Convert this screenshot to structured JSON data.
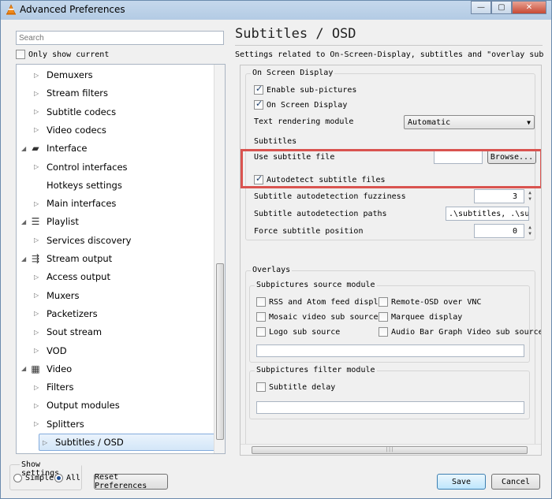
{
  "window": {
    "title": "Advanced Preferences",
    "minimize": "—",
    "maximize": "▢",
    "close": "✕"
  },
  "search": {
    "placeholder": "Search"
  },
  "only_current": {
    "label": "Only show current",
    "checked": false
  },
  "tree": {
    "items": [
      {
        "label": "Demuxers",
        "level": 1,
        "arrow": "▷"
      },
      {
        "label": "Stream filters",
        "level": 1,
        "arrow": "▷"
      },
      {
        "label": "Subtitle codecs",
        "level": 1,
        "arrow": "▷"
      },
      {
        "label": "Video codecs",
        "level": 1,
        "arrow": "▷"
      },
      {
        "label": "Interface",
        "level": 0,
        "arrow": "◢",
        "icon": "paint-roller-icon"
      },
      {
        "label": "Control interfaces",
        "level": 1,
        "arrow": "▷"
      },
      {
        "label": "Hotkeys settings",
        "level": 1,
        "arrow": ""
      },
      {
        "label": "Main interfaces",
        "level": 1,
        "arrow": "▷"
      },
      {
        "label": "Playlist",
        "level": 0,
        "arrow": "◢",
        "icon": "playlist-icon"
      },
      {
        "label": "Services discovery",
        "level": 1,
        "arrow": "▷"
      },
      {
        "label": "Stream output",
        "level": 0,
        "arrow": "◢",
        "icon": "stream-output-icon"
      },
      {
        "label": "Access output",
        "level": 1,
        "arrow": "▷"
      },
      {
        "label": "Muxers",
        "level": 1,
        "arrow": "▷"
      },
      {
        "label": "Packetizers",
        "level": 1,
        "arrow": "▷"
      },
      {
        "label": "Sout stream",
        "level": 1,
        "arrow": "▷"
      },
      {
        "label": "VOD",
        "level": 1,
        "arrow": "▷"
      },
      {
        "label": "Video",
        "level": 0,
        "arrow": "◢",
        "icon": "film-icon"
      },
      {
        "label": "Filters",
        "level": 1,
        "arrow": "▷"
      },
      {
        "label": "Output modules",
        "level": 1,
        "arrow": "▷"
      },
      {
        "label": "Splitters",
        "level": 1,
        "arrow": "▷"
      },
      {
        "label": "Subtitles / OSD",
        "level": 1,
        "arrow": "▷",
        "selected": true
      }
    ]
  },
  "show_settings": {
    "legend": "Show settings",
    "simple": "Simple",
    "all": "All",
    "selected": "All"
  },
  "buttons": {
    "reset": "Reset Preferences",
    "save": "Save",
    "cancel": "Cancel"
  },
  "panel": {
    "title": "Subtitles / OSD",
    "description": "Settings related to On-Screen-Display, subtitles and \"overlay subpictures\"",
    "osd": {
      "legend": "On Screen Display",
      "enable_subpictures": "Enable sub-pictures",
      "on_screen_display": "On Screen Display",
      "text_rendering_label": "Text rendering module",
      "text_rendering_value": "Automatic"
    },
    "subtitles": {
      "legend": "Subtitles",
      "use_file_label": "Use subtitle file",
      "use_file_value": "",
      "browse": "Browse..."
    },
    "autodetect_label": "Autodetect subtitle files",
    "fuzziness_label": "Subtitle autodetection fuzziness",
    "fuzziness_value": "3",
    "paths_label": "Subtitle autodetection paths",
    "paths_value": ".\\subtitles, .\\subs",
    "force_position_label": "Force subtitle position",
    "force_position_value": "0",
    "overlays": {
      "legend": "Overlays",
      "source_legend": "Subpictures source module",
      "source_options": [
        "RSS and Atom feed display",
        "Remote-OSD over VNC",
        "Mosaic video sub source",
        "Marquee display",
        "Logo sub source",
        "Audio Bar Graph Video sub source"
      ],
      "filter_legend": "Subpictures filter module",
      "filter_option": "Subtitle delay"
    }
  },
  "colors": {
    "highlight_box": "#d9534f",
    "selection": "#d3e6f8"
  }
}
